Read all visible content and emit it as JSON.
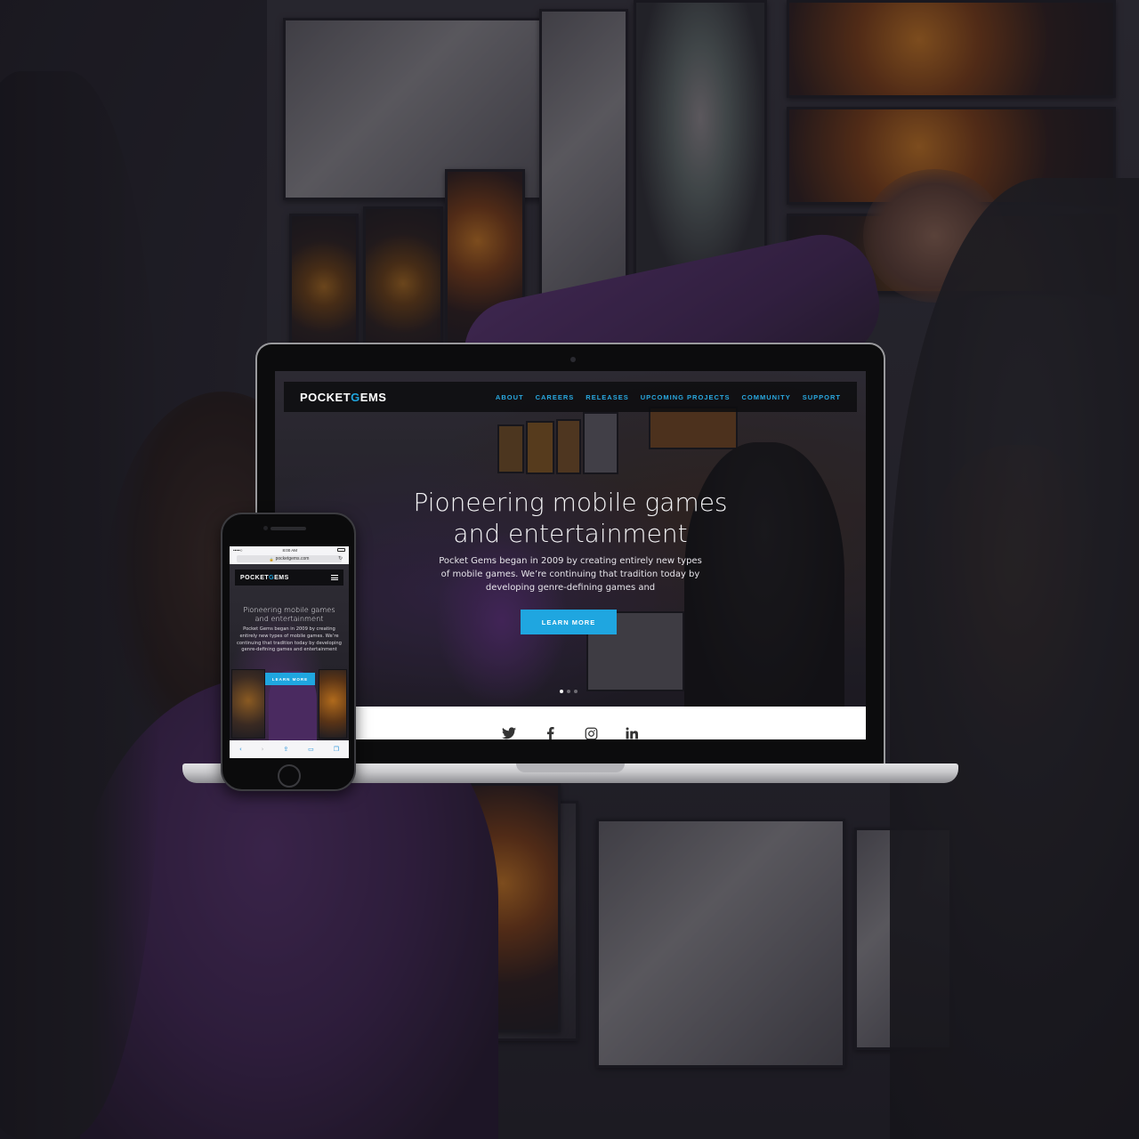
{
  "brand": {
    "logo_pre": "POCKET",
    "logo_accent": "G",
    "logo_post": "EMS",
    "accent_color": "#1fa6e0"
  },
  "desktop": {
    "nav": [
      "ABOUT",
      "CAREERS",
      "RELEASES",
      "UPCOMING PROJECTS",
      "COMMUNITY",
      "SUPPORT"
    ],
    "headline_line1": "Pioneering mobile games",
    "headline_line2": "and entertainment",
    "subcopy": "Pocket Gems began in 2009 by creating entirely new types of mobile games. We’re continuing that tradition today by developing genre-defining games and",
    "cta": "LEARN MORE",
    "carousel": {
      "slides": 3,
      "active": 1
    },
    "social_icons": [
      "twitter-icon",
      "facebook-icon",
      "instagram-icon",
      "linkedin-icon"
    ]
  },
  "mobile": {
    "status_carrier": "•••••○ ",
    "status_time": "8:00 AM",
    "url": "pocketgems.com",
    "headline_line1": "Pioneering mobile games",
    "headline_line2": "and entertainment",
    "subcopy": "Pocket Gems began in 2009 by creating entirely new types of mobile games. We’re continuing that tradition today by developing genre-defining games and entertainment",
    "cta": "LEARN MORE",
    "toolbar_icons": [
      "back-icon",
      "forward-icon",
      "share-icon",
      "bookmarks-icon",
      "tabs-icon"
    ]
  }
}
